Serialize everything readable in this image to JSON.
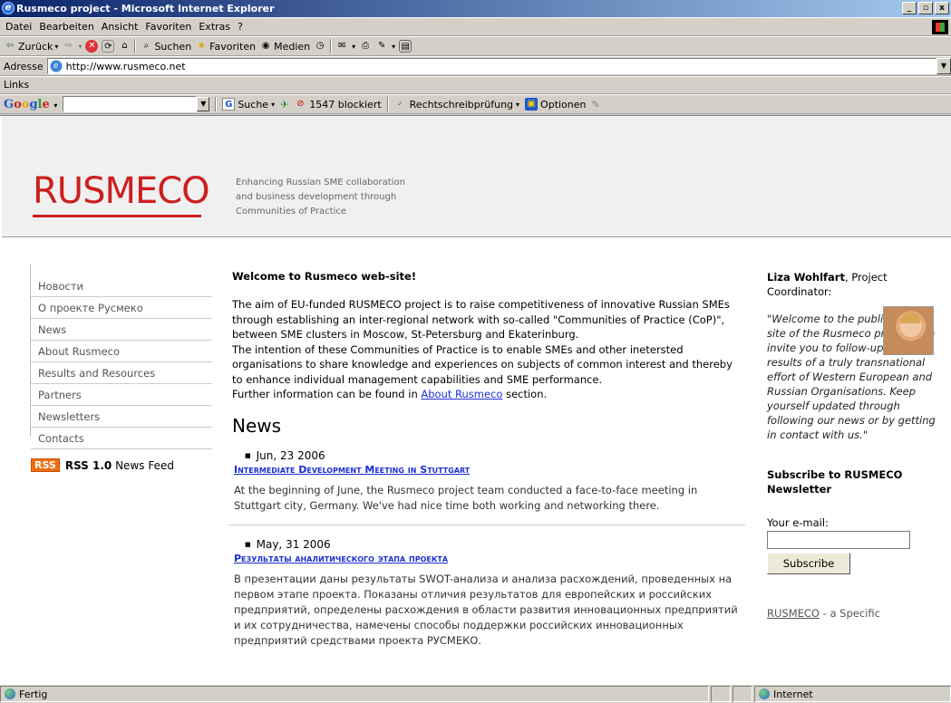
{
  "window": {
    "title": "Rusmeco project - Microsoft Internet Explorer",
    "buttons": [
      "_",
      "▫",
      "x"
    ]
  },
  "menubar": [
    "Datei",
    "Bearbeiten",
    "Ansicht",
    "Favoriten",
    "Extras",
    "?"
  ],
  "toolbar": {
    "back": "Zurück",
    "search": "Suchen",
    "favorites": "Favoriten",
    "media": "Medien"
  },
  "address": {
    "label": "Adresse",
    "url": "http://www.rusmeco.net"
  },
  "links_label": "Links",
  "google_toolbar": {
    "logo": [
      "G",
      "o",
      "o",
      "g",
      "l",
      "e"
    ],
    "search_label": "Suche",
    "blocked": "1547 blockiert",
    "spellcheck": "Rechtschreibprüfung",
    "options": "Optionen"
  },
  "page": {
    "logo": "RUSMECO",
    "tagline": [
      "Enhancing Russian SME collaboration",
      "and business development through",
      "Communities of Practice"
    ],
    "nav": [
      "Новости",
      "О проекте Русмеко",
      "News",
      "About Rusmeco",
      "Results and Resources",
      "Partners",
      "Newsletters",
      "Contacts"
    ],
    "rss": {
      "badge": "RSS",
      "version": "RSS 1.0",
      "label": "News Feed"
    },
    "welcome_title": "Welcome to Rusmeco web-site!",
    "intro_1": "The aim of EU-funded RUSMECO project is to raise competitiveness of innovative Russian SMEs through establishing an inter-regional network with so-called \"Communities of Practice (CoP)\", between SME clusters in Moscow, St-Petersburg and Ekaterinburg.",
    "intro_2": "The intention of these Communities of Practice is to enable SMEs and other inetersted organisations to share knowledge and experiences on subjects of common interest and thereby to enhance individual management capabilities and SME performance.",
    "intro_3_prefix": "Further information can be found in ",
    "intro_3_link": "About Rusmeco",
    "intro_3_suffix": " section.",
    "news_heading": "News",
    "news": [
      {
        "date": "Jun, 23 2006",
        "title": "Intermediate Development Meeting in Stuttgart",
        "body": "At the beginning of June, the Rusmeco project team conducted a face-to-face meeting in Stuttgart city, Germany. We've had nice time both working and networking there."
      },
      {
        "date": "May, 31 2006",
        "title": "Результаты аналитического этапа проекта",
        "body": "В презентации даны результаты SWOT-анализа и анализа расхождений, проведенных на первом этапе проекта. Показаны отличия результатов для европейских и российских предприятий, определены расхождения в области развития инновационных предприятий и их сотрудничества, намечены способы поддержки российских инновационных предприятий средствами проекта РУСМЕКО."
      }
    ],
    "coordinator": {
      "name": "Liza Wohlfart",
      "role": ", Project Coordinator:",
      "quote": "\"Welcome to the public project site of the Rusmeco project! We invite you to follow-up the results of a truly transnational effort of Western European and Russian Organisations. Keep yourself updated through following our news or by getting in contact with us.\""
    },
    "subscribe": {
      "title": "Subscribe to RUSMECO Newsletter",
      "email_label": "Your e-mail:",
      "email_value": "",
      "button": "Subscribe"
    },
    "footer_snippet": {
      "name": "RUSMECO",
      "text": " - a Specific"
    }
  },
  "status": {
    "left": "Fertig",
    "zone": "Internet"
  }
}
